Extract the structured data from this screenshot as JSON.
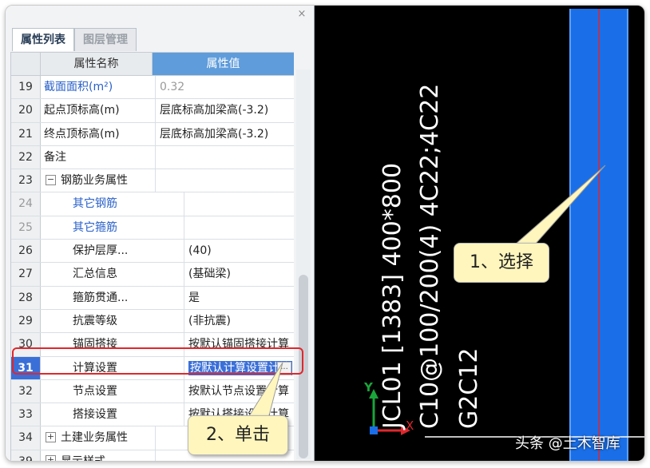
{
  "panel": {
    "close": "×",
    "tabs": [
      {
        "label": "属性列表",
        "active": true
      },
      {
        "label": "图层管理",
        "active": false
      }
    ],
    "columns": {
      "name": "属性名称",
      "value": "属性值"
    },
    "rows": [
      {
        "num": "19",
        "name": "截面面积(m²)",
        "value": "0.32",
        "style": "blue-grey"
      },
      {
        "num": "20",
        "name": "起点顶标高(m)",
        "value": "层底标高加梁高(-3.2)"
      },
      {
        "num": "21",
        "name": "终点顶标高(m)",
        "value": "层底标高加梁高(-3.2)"
      },
      {
        "num": "22",
        "name": "备注",
        "value": ""
      },
      {
        "num": "23",
        "name": "钢筋业务属性",
        "value": "",
        "expander": "−"
      },
      {
        "num": "24",
        "name": "其它钢筋",
        "value": "",
        "style": "blue",
        "indent": true
      },
      {
        "num": "25",
        "name": "其它箍筋",
        "value": "",
        "style": "blue",
        "indent": true
      },
      {
        "num": "26",
        "name": "保护层厚...",
        "value": "(40)",
        "indent": true
      },
      {
        "num": "27",
        "name": "汇总信息",
        "value": "(基础梁)",
        "indent": true
      },
      {
        "num": "28",
        "name": "箍筋贯通...",
        "value": "是",
        "indent": true
      },
      {
        "num": "29",
        "name": "抗震等级",
        "value": "(非抗震)",
        "indent": true
      },
      {
        "num": "30",
        "name": "锚固搭接",
        "value": "按默认锚固搭接计算",
        "indent": true
      },
      {
        "num": "31",
        "name": "计算设置",
        "value": "按默认计算设置计算",
        "indent": true,
        "selected": true,
        "button": "..."
      },
      {
        "num": "32",
        "name": "节点设置",
        "value": "按默认节点设置计算",
        "indent": true
      },
      {
        "num": "33",
        "name": "搭接设置",
        "value": "按默认搭接设置计算",
        "indent": true
      },
      {
        "num": "34",
        "name": "土建业务属性",
        "value": "",
        "expander": "+"
      },
      {
        "num": "39",
        "name": "显示样式",
        "value": "",
        "expander": "+"
      }
    ]
  },
  "cad": {
    "lines": [
      "JCL01 [1383] 400*800",
      "C10@100/200(4) 4C22;4C22",
      "G2C12"
    ],
    "axis": {
      "y": "Y",
      "x": "X"
    }
  },
  "callouts": {
    "select": "1、选择",
    "click": "2、单击"
  },
  "watermark": "头条 @土木智库",
  "colors": {
    "beam": "#1a6fe8",
    "highlight": "#e0272d",
    "selection": "#3a6fd8",
    "callout": "#fff6bd"
  }
}
